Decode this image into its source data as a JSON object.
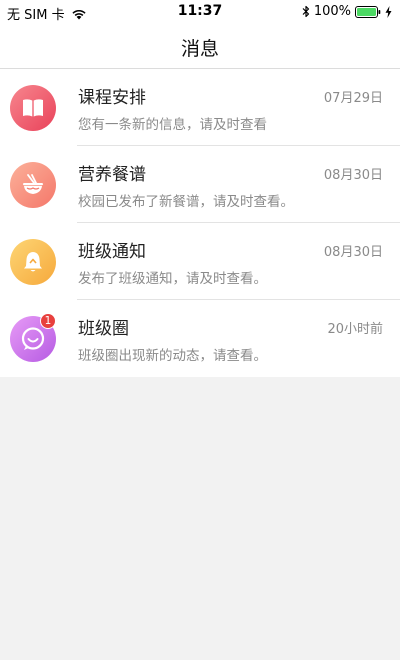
{
  "status_bar": {
    "carrier": "无 SIM 卡",
    "time": "11:37",
    "battery_percent": "100%",
    "battery_level": 1.0,
    "icons": [
      "wifi-icon",
      "bluetooth-icon",
      "battery-icon",
      "charging-icon"
    ]
  },
  "nav": {
    "title": "消息"
  },
  "messages": [
    {
      "title": "课程安排",
      "subtitle": "您有一条新的信息，请及时查看",
      "time": "07月29日",
      "icon": "book-icon",
      "color_from": "#f7868e",
      "color_to": "#e9425a"
    },
    {
      "title": "营养餐谱",
      "subtitle": "校园已发布了新餐谱，请及时查看。",
      "time": "08月30日",
      "icon": "noodle-bowl-icon",
      "color_from": "#fcb19a",
      "color_to": "#f4776a"
    },
    {
      "title": "班级通知",
      "subtitle": "发布了班级通知，请及时查看。",
      "time": "08月30日",
      "icon": "bell-icon",
      "color_from": "#fdd574",
      "color_to": "#f6a93c"
    },
    {
      "title": "班级圈",
      "subtitle": "班级圈出现新的动态，请查看。",
      "time": "20小时前",
      "icon": "chat-bubble-icon",
      "color_from": "#e79bf6",
      "color_to": "#b65be3",
      "unread": "1"
    }
  ]
}
